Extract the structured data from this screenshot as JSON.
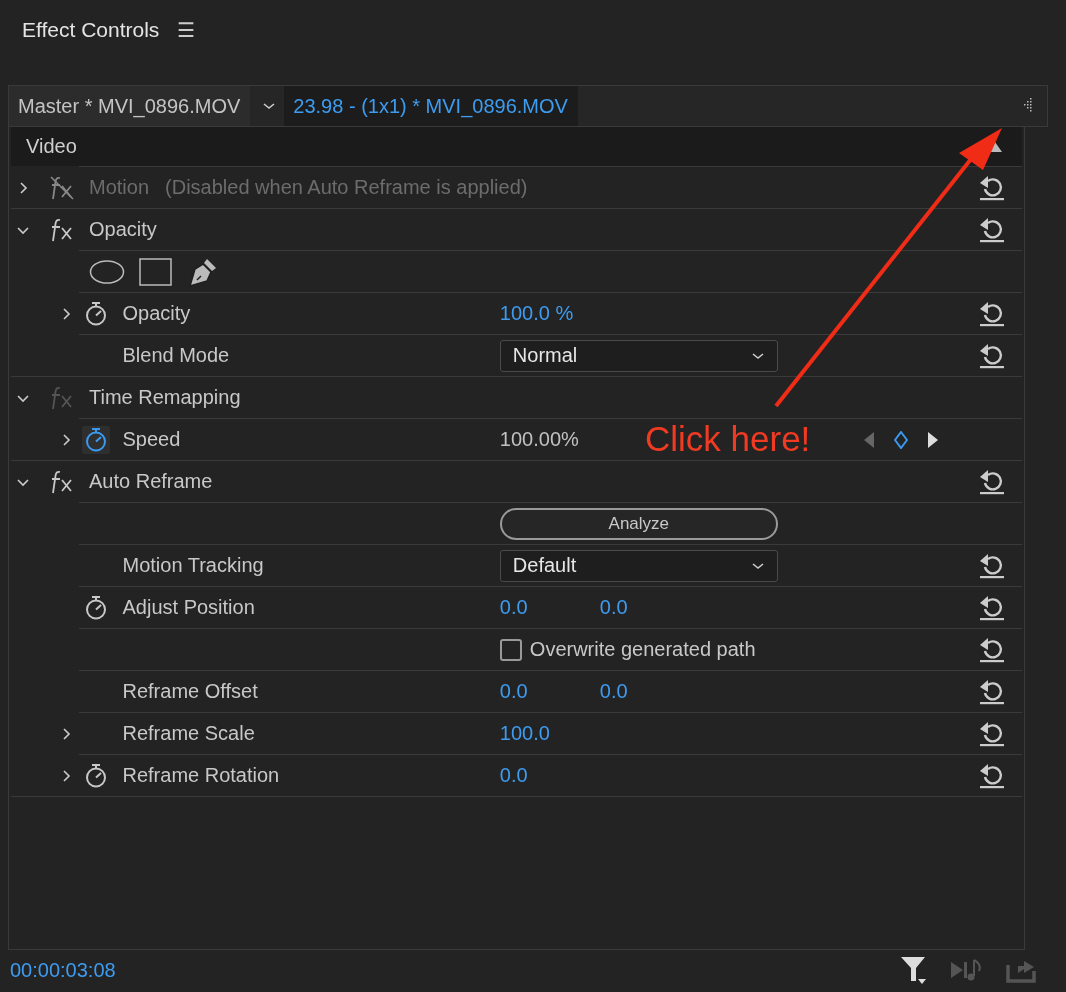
{
  "panel": {
    "title": "Effect Controls",
    "menu_glyph": "☰"
  },
  "tabs": [
    {
      "label": "Master * MVI_0896.MOV",
      "selected": false
    },
    {
      "label": "23.98 - (1x1) * MVI_0896.MOV",
      "selected": true
    }
  ],
  "section": {
    "label": "Video"
  },
  "rows": [
    {
      "kind": "effect",
      "name": "Motion",
      "note": "(Disabled when Auto Reframe is applied)",
      "expanded": false,
      "bypassed": true,
      "fixed": false,
      "disabled": true,
      "reset": true
    },
    {
      "kind": "effect",
      "name": "Opacity",
      "expanded": true,
      "bypassed": false,
      "fixed": false,
      "disabled": false,
      "reset": true
    },
    {
      "kind": "masks"
    },
    {
      "kind": "property",
      "label": "Opacity",
      "expanded": false,
      "stopwatch": true,
      "animating": false,
      "values": [
        "100.0 %"
      ],
      "reset": true
    },
    {
      "kind": "property",
      "label": "Blend Mode",
      "control": {
        "kind": "dropdown",
        "value": "Normal"
      },
      "reset": true
    },
    {
      "kind": "effect",
      "name": "Time Remapping",
      "expanded": true,
      "bypassed": false,
      "fixed": true,
      "disabled": false,
      "reset": false
    },
    {
      "kind": "property",
      "label": "Speed",
      "expanded": false,
      "stopwatch": true,
      "animating": true,
      "plain_values": [
        "100.00%"
      ],
      "keyframe_nav": true,
      "reset": false
    },
    {
      "kind": "effect",
      "name": "Auto Reframe",
      "expanded": true,
      "bypassed": false,
      "fixed": false,
      "disabled": false,
      "reset": true
    },
    {
      "kind": "property",
      "control": {
        "kind": "button",
        "label": "Analyze"
      },
      "reset": false
    },
    {
      "kind": "property",
      "label": "Motion Tracking",
      "control": {
        "kind": "dropdown",
        "value": "Default"
      },
      "reset": true
    },
    {
      "kind": "property",
      "label": "Adjust Position",
      "stopwatch": true,
      "animating": false,
      "values": [
        "0.0",
        "0.0"
      ],
      "reset": true
    },
    {
      "kind": "property",
      "control": {
        "kind": "checkbox",
        "label": "Overwrite generated path",
        "checked": false
      },
      "reset": true
    },
    {
      "kind": "property",
      "label": "Reframe Offset",
      "values": [
        "0.0",
        "0.0"
      ],
      "reset": true
    },
    {
      "kind": "property",
      "label": "Reframe Scale",
      "expanded": false,
      "values": [
        "100.0"
      ],
      "reset": true
    },
    {
      "kind": "property",
      "label": "Reframe Rotation",
      "expanded": false,
      "stopwatch": true,
      "animating": false,
      "values": [
        "0.0"
      ],
      "reset": true
    }
  ],
  "annotation": {
    "text": "Click here!"
  },
  "footer": {
    "timecode": "00:00:03:08"
  }
}
